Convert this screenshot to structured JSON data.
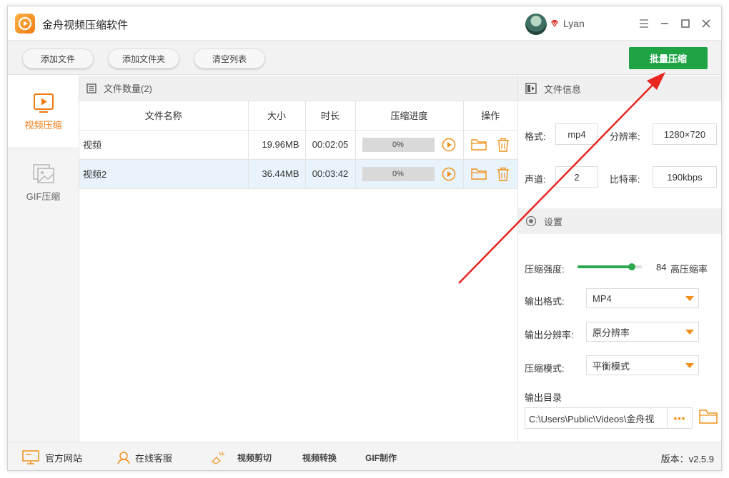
{
  "app": {
    "title": "金舟视频压缩软件",
    "username": "Lyan"
  },
  "toolbar": {
    "add_file": "添加文件",
    "add_folder": "添加文件夹",
    "clear_list": "清空列表",
    "batch_compress": "批量压缩"
  },
  "sidebar": {
    "items": [
      {
        "label": "视频压缩",
        "active": true,
        "icon": "video-play-icon"
      },
      {
        "label": "GIF压缩",
        "active": false,
        "icon": "image-icon"
      }
    ]
  },
  "file_panel": {
    "header": "文件数量(2)",
    "columns": [
      "文件名称",
      "大小",
      "时长",
      "压缩进度",
      "操作"
    ],
    "rows": [
      {
        "name": "视频",
        "size": "19.96MB",
        "duration": "00:02:05",
        "progress": "0%",
        "selected": false
      },
      {
        "name": "视频2",
        "size": "36.44MB",
        "duration": "00:03:42",
        "progress": "0%",
        "selected": true
      }
    ]
  },
  "file_info": {
    "header": "文件信息",
    "format_label": "格式:",
    "format_value": "mp4",
    "resolution_label": "分辨率:",
    "resolution_value": "1280×720",
    "channel_label": "声道:",
    "channel_value": "2",
    "bitrate_label": "比特率:",
    "bitrate_value": "190kbps"
  },
  "settings": {
    "header": "设置",
    "strength_label": "压缩强度:",
    "strength_value": "84",
    "strength_fraction": 0.84,
    "strength_desc": "高压缩率",
    "output_format_label": "输出格式:",
    "output_format_value": "MP4",
    "output_resolution_label": "输出分辨率:",
    "output_resolution_value": "原分辨率",
    "mode_label": "压缩模式:",
    "mode_value": "平衡模式",
    "output_dir_label": "输出目录",
    "output_dir_value": "C:\\Users\\Public\\Videos\\金舟视",
    "more_label": "•••"
  },
  "statusbar": {
    "website": "官方网站",
    "support": "在线客服",
    "video_cut": "视频剪切",
    "video_convert": "视频转换",
    "gif_make": "GIF制作",
    "version": "版本：v2.5.9"
  },
  "colors": {
    "accent_green": "#1ea445",
    "accent_orange": "#f07a12",
    "arrow_red": "#e8251f"
  }
}
